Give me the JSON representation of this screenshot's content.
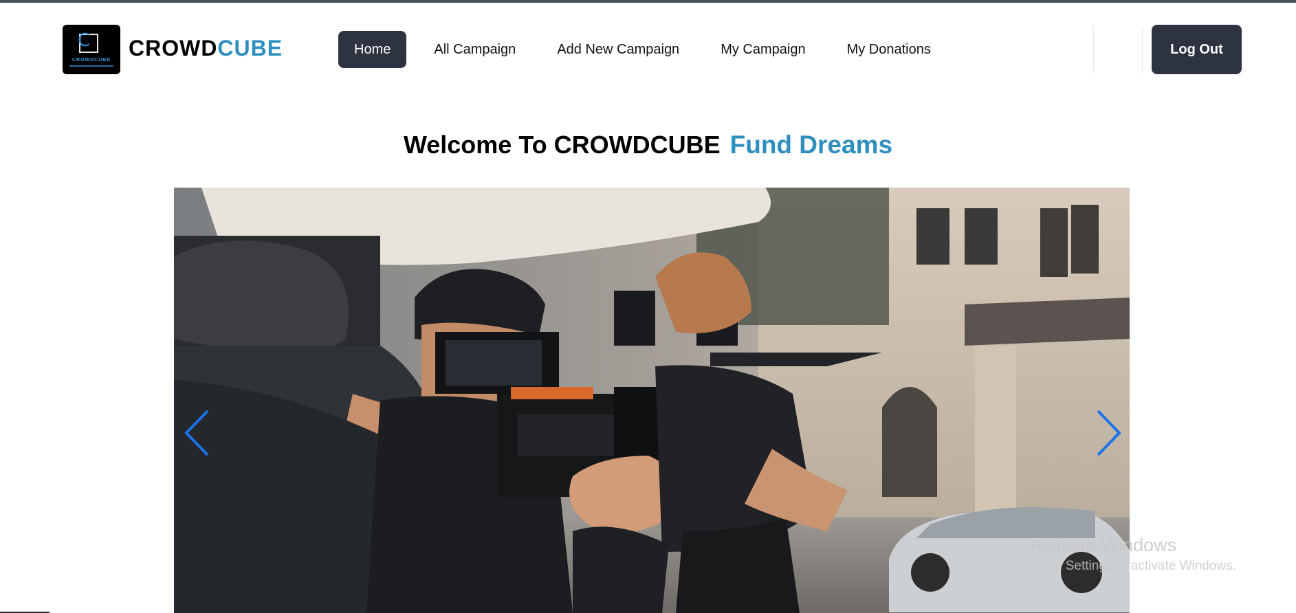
{
  "navbar": {
    "logo_tag": "CROWDCUBE",
    "brand_part1": "CROWD",
    "brand_part2": "CUBE",
    "links": [
      {
        "label": "Home",
        "active": true
      },
      {
        "label": "All Campaign"
      },
      {
        "label": "Add New Campaign"
      },
      {
        "label": "My Campaign"
      },
      {
        "label": "My Donations"
      }
    ],
    "logout_label": "Log Out"
  },
  "hero": {
    "welcome": "Welcome To CROWDCUBE",
    "tagline": "Fund Dreams"
  },
  "carousel": {
    "prev_icon": "chevron-left-icon",
    "next_icon": "chevron-right-icon",
    "arrow_color": "#1a73e8"
  },
  "watermark": {
    "line1": "Activate Windows",
    "line2": "Go to Settings to activate Windows."
  },
  "colors": {
    "accent": "#2e8fbf",
    "dark_button": "#2d3340"
  }
}
